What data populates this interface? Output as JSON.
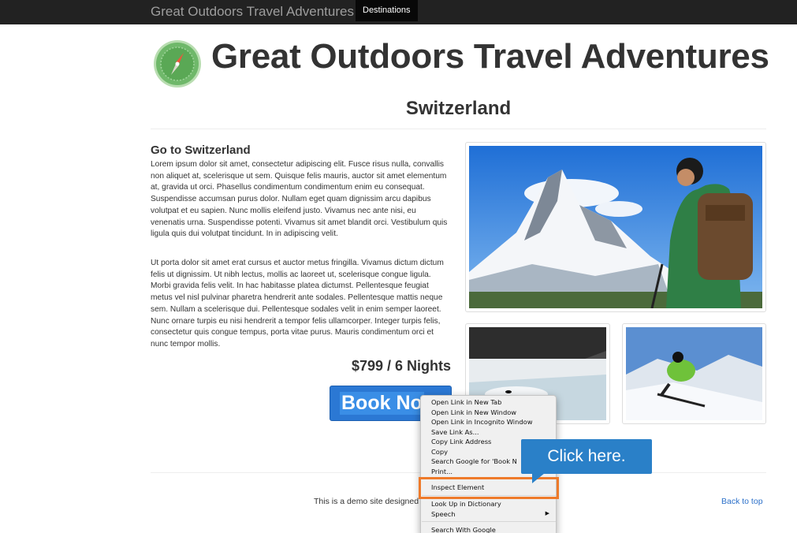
{
  "navbar": {
    "brand": "Great Outdoors Travel Adventures",
    "active_item": "Destinations"
  },
  "header": {
    "logo_icon": "compass-icon",
    "title": "Great Outdoors Travel Adventures"
  },
  "page": {
    "heading": "Switzerland",
    "subheading": "Go to Switzerland",
    "paragraph1": "Lorem ipsum dolor sit amet, consectetur adipiscing elit. Fusce risus nulla, convallis non aliquet at, scelerisque ut sem. Quisque felis mauris, auctor sit amet elementum at, gravida ut orci. Phasellus condimentum condimentum enim eu consequat. Suspendisse accumsan purus dolor. Nullam eget quam dignissim arcu dapibus volutpat et eu sapien. Nunc mollis eleifend justo. Vivamus nec ante nisi, eu venenatis urna. Suspendisse potenti. Vivamus sit amet blandit orci. Vestibulum quis ligula quis dui volutpat tincidunt. In in adipiscing velit.",
    "paragraph2": "Ut porta dolor sit amet erat cursus et auctor metus fringilla. Vivamus dictum dictum felis ut dignissim. Ut nibh lectus, mollis ac laoreet ut, scelerisque congue ligula. Morbi gravida felis velit. In hac habitasse platea dictumst. Pellentesque feugiat metus vel nisl pulvinar pharetra hendrerit ante sodales. Pellentesque mattis neque sem. Nullam a scelerisque dui. Pellentesque sodales velit in enim semper laoreet. Nunc ornare turpis eu nisi hendrerit a tempor felis ullamcorper. Integer turpis felis, consectetur quis congue tempus, porta vitae purus. Mauris condimentum orci et nunc tempor mollis.",
    "price": "$799 / 6 Nights",
    "book_button": "Book No"
  },
  "footer": {
    "text": "This is a demo site designed",
    "back_to_top": "Back to top"
  },
  "context_menu": {
    "items": [
      "Open Link in New Tab",
      "Open Link in New Window",
      "Open Link in Incognito Window",
      "Save Link As...",
      "Copy Link Address",
      "Copy",
      "Search Google for 'Book N",
      "Print...",
      "Inspect Element",
      "Look Up in Dictionary",
      "Speech",
      "Search With Google"
    ]
  },
  "callout": {
    "text": "Click here.",
    "color": "#2a80c8",
    "highlight_color": "#ee7a2a"
  }
}
